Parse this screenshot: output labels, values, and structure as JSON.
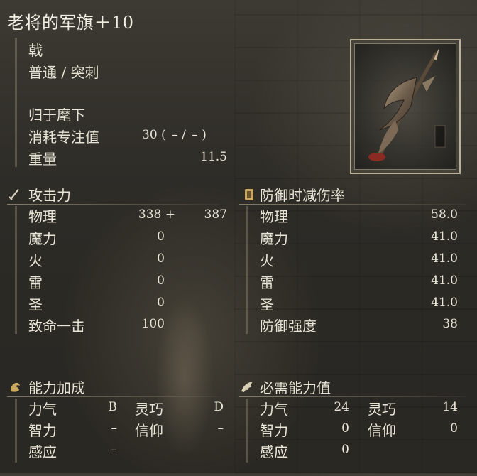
{
  "weapon": {
    "name": "老将的军旗＋10",
    "type": "戟",
    "attack_type": "普通 / 突刺",
    "skill": "归于麾下",
    "fp_label": "消耗专注值",
    "fp_value": "30 ( – / – )",
    "weight_label": "重量",
    "weight_value": "11.5"
  },
  "attack": {
    "header": "攻击力",
    "icon": "sword-icon",
    "rows": [
      {
        "label": "物理",
        "base": "338 +",
        "bonus": "387"
      },
      {
        "label": "魔力",
        "base": "0",
        "bonus": ""
      },
      {
        "label": "火",
        "base": "0",
        "bonus": ""
      },
      {
        "label": "雷",
        "base": "0",
        "bonus": ""
      },
      {
        "label": "圣",
        "base": "0",
        "bonus": ""
      },
      {
        "label": "致命一击",
        "base": "100",
        "bonus": ""
      }
    ]
  },
  "guard": {
    "header": "防御时减伤率",
    "icon": "shield-icon",
    "rows": [
      {
        "label": "物理",
        "value": "58.0"
      },
      {
        "label": "魔力",
        "value": "41.0"
      },
      {
        "label": "火",
        "value": "41.0"
      },
      {
        "label": "雷",
        "value": "41.0"
      },
      {
        "label": "圣",
        "value": "41.0"
      },
      {
        "label": "防御强度",
        "value": "38"
      }
    ]
  },
  "scaling": {
    "header": "能力加成",
    "icon": "flexed-arm-icon",
    "rows": [
      {
        "l1": "力气",
        "v1": "B",
        "l2": "灵巧",
        "v2": "D"
      },
      {
        "l1": "智力",
        "v1": "–",
        "l2": "信仰",
        "v2": "–"
      },
      {
        "l1": "感应",
        "v1": "–",
        "l2": "",
        "v2": ""
      }
    ]
  },
  "requirements": {
    "header": "必需能力值",
    "icon": "wing-icon",
    "rows": [
      {
        "l1": "力气",
        "v1": "24",
        "l2": "灵巧",
        "v2": "14"
      },
      {
        "l1": "智力",
        "v1": "0",
        "l2": "信仰",
        "v2": "0"
      },
      {
        "l1": "感应",
        "v1": "0",
        "l2": "",
        "v2": ""
      }
    ]
  },
  "colors": {
    "text": "#e8e4d6",
    "accent_gold": "#c8a860",
    "blood": "#8a2a22"
  }
}
